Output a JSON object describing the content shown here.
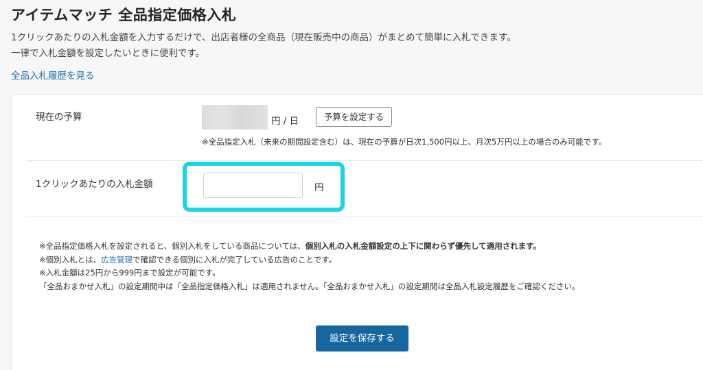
{
  "header": {
    "title": "アイテムマッチ 全品指定価格入札",
    "description_lines": [
      "1クリックあたりの入札金額を入力するだけで、出店者様の全商品（現在販売中の商品）がまとめて簡単に入札できます。",
      "一律で入札金額を設定したいときに便利です。"
    ],
    "history_link": "全品入札履歴を見る"
  },
  "budget_row": {
    "label": "現在の予算",
    "unit": "円 / 日",
    "set_budget_button": "予算を設定する",
    "note": "※全品指定入札（未来の期間設定含む）は、現在の予算が日次1,500円以上、月次5万円以上の場合のみ可能です。"
  },
  "bid_row": {
    "label": "1クリックあたりの入札金額",
    "input_value": "",
    "input_placeholder": "",
    "unit": "円"
  },
  "notes": {
    "line1_prefix": "※全品指定価格入札を設定されると、個別入札をしている商品については、",
    "line1_bold": "個別入札の入札金額設定の上下に関わらず優先して適用されます。",
    "line2_prefix": "※個別入札とは、",
    "line2_link": "広告管理",
    "line2_suffix": "で確認できる個別に入札が完了している広告のことです。",
    "line3": "※入札金額は25円から999円まで設定が可能です。",
    "line4": "「全品おまかせ入札」の設定期間中は「全品指定価格入札」は適用されません。「全品おまかせ入札」の設定期間は全品入札設定履歴をご確認ください。"
  },
  "footer": {
    "save_button": "設定を保存する"
  },
  "colors": {
    "accent": "#1667a0",
    "link": "#1f6fad",
    "highlight": "#1fd3e6",
    "background": "#f6f7f8"
  }
}
